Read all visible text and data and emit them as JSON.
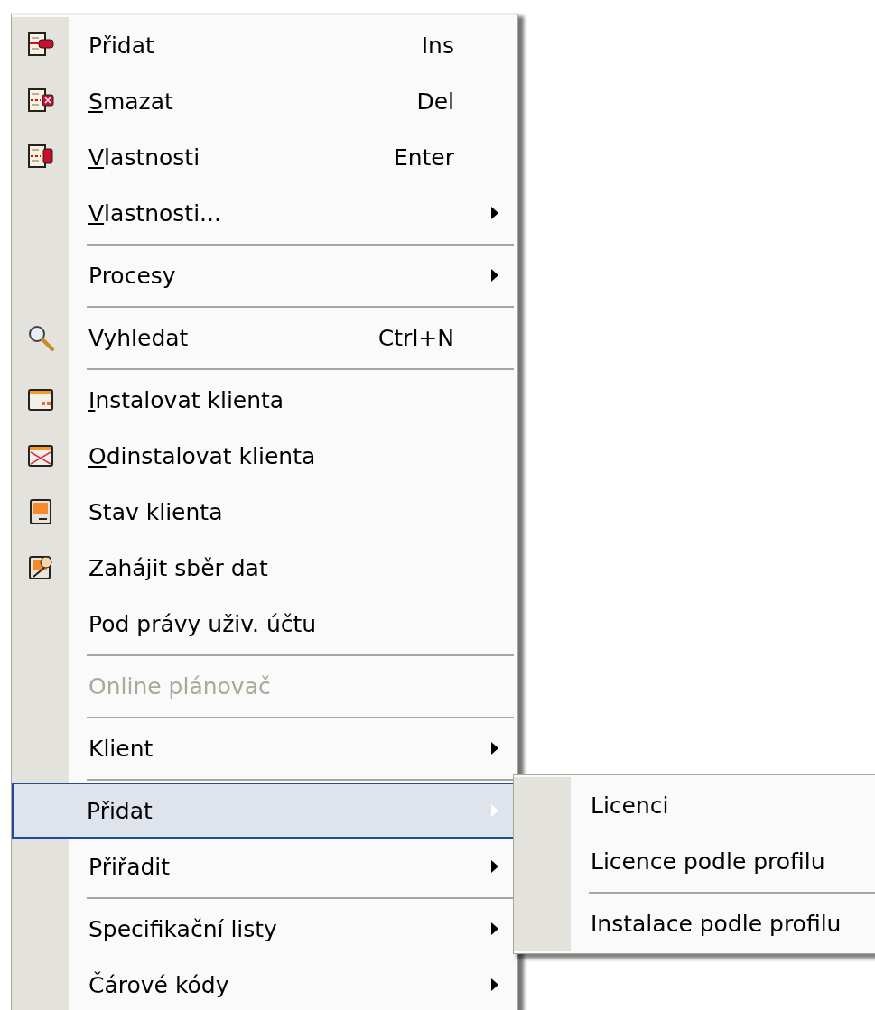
{
  "menu": {
    "items": [
      {
        "kind": "item",
        "label": "Přidat",
        "shortcut": "Ins",
        "mnemonic": false,
        "submenu": false,
        "disabled": false,
        "selected": false
      },
      {
        "kind": "item",
        "label": "Smazat",
        "shortcut": "Del",
        "mnemonic": true,
        "submenu": false,
        "disabled": false,
        "selected": false
      },
      {
        "kind": "item",
        "label": "Vlastnosti",
        "shortcut": "Enter",
        "mnemonic": true,
        "submenu": false,
        "disabled": false,
        "selected": false
      },
      {
        "kind": "item",
        "label": "Vlastnosti...",
        "mnemonic": true,
        "submenu": true,
        "disabled": false,
        "selected": false
      },
      {
        "kind": "separator"
      },
      {
        "kind": "item",
        "label": "Procesy",
        "mnemonic": false,
        "submenu": true,
        "disabled": false,
        "selected": false
      },
      {
        "kind": "separator"
      },
      {
        "kind": "item",
        "label": "Vyhledat",
        "shortcut": "Ctrl+N",
        "mnemonic": false,
        "submenu": false,
        "disabled": false,
        "selected": false
      },
      {
        "kind": "separator"
      },
      {
        "kind": "item",
        "label": "Instalovat klienta",
        "mnemonic": true,
        "submenu": false,
        "disabled": false,
        "selected": false
      },
      {
        "kind": "item",
        "label": "Odinstalovat klienta",
        "mnemonic": true,
        "submenu": false,
        "disabled": false,
        "selected": false
      },
      {
        "kind": "item",
        "label": "Stav klienta",
        "mnemonic": false,
        "submenu": false,
        "disabled": false,
        "selected": false
      },
      {
        "kind": "item",
        "label": "Zahájit sběr dat",
        "mnemonic": false,
        "submenu": false,
        "disabled": false,
        "selected": false
      },
      {
        "kind": "item",
        "label": "Pod právy uživ. účtu",
        "mnemonic": false,
        "submenu": false,
        "disabled": false,
        "selected": false
      },
      {
        "kind": "separator"
      },
      {
        "kind": "item",
        "label": "Online plánovač",
        "mnemonic": false,
        "submenu": false,
        "disabled": true,
        "selected": false
      },
      {
        "kind": "separator"
      },
      {
        "kind": "item",
        "label": "Klient",
        "mnemonic": false,
        "submenu": true,
        "disabled": false,
        "selected": false
      },
      {
        "kind": "separator"
      },
      {
        "kind": "item",
        "label": "Přidat",
        "mnemonic": false,
        "submenu": true,
        "disabled": false,
        "selected": true
      },
      {
        "kind": "item",
        "label": "Přiřadit",
        "mnemonic": false,
        "submenu": true,
        "disabled": false,
        "selected": false
      },
      {
        "kind": "separator"
      },
      {
        "kind": "item",
        "label": "Specifikační listy",
        "mnemonic": false,
        "submenu": true,
        "disabled": false,
        "selected": false
      },
      {
        "kind": "item",
        "label": "Čárové kódy",
        "mnemonic": false,
        "submenu": true,
        "disabled": false,
        "selected": false
      }
    ]
  },
  "submenu": {
    "items": [
      {
        "kind": "item",
        "label": "Licenci",
        "mnemonic": false,
        "submenu": false,
        "disabled": false,
        "selected": false
      },
      {
        "kind": "item",
        "label": "Licence podle profilu",
        "mnemonic": false,
        "submenu": false,
        "disabled": false,
        "selected": false
      },
      {
        "kind": "separator"
      },
      {
        "kind": "item",
        "label": "Instalace podle profilu",
        "mnemonic": false,
        "submenu": false,
        "disabled": false,
        "selected": false
      }
    ]
  }
}
